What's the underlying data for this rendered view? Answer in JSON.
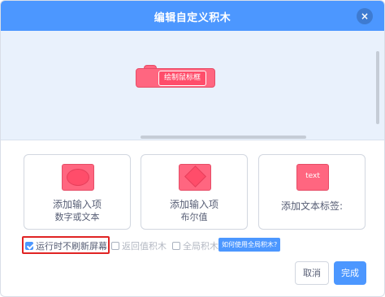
{
  "dialog": {
    "title": "编辑自定义积木",
    "close_glyph": "×"
  },
  "workspace": {
    "block_label": "绘制鼠标框"
  },
  "cards": [
    {
      "title": "添加输入项",
      "subtitle": "数字或文本",
      "icon": "oval-input-icon"
    },
    {
      "title": "添加输入项",
      "subtitle": "布尔值",
      "icon": "diamond-input-icon"
    },
    {
      "title": "添加文本标签:",
      "icon_text": "text",
      "icon": "text-label-icon"
    }
  ],
  "options": {
    "run_without_refresh": {
      "label": "运行时不刷新屏幕",
      "checked": true
    },
    "return_value": {
      "label": "返回值积木",
      "checked": false
    },
    "global": {
      "label": "全局积木",
      "checked": false
    },
    "help_label": "如何使用全局积木?"
  },
  "footer": {
    "cancel_label": "取消",
    "done_label": "完成"
  },
  "colors": {
    "accent": "#4c97ff",
    "block": "#ff6680",
    "highlight": "#e02424"
  }
}
